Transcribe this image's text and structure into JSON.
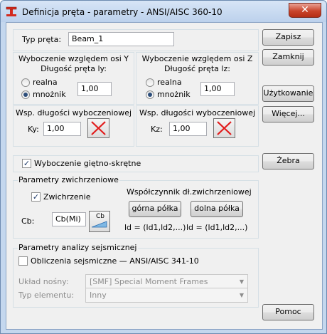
{
  "window": {
    "title": "Definicja pręta - parametry - ANSI/AISC 360-10",
    "close_glyph": "✕"
  },
  "member_type": {
    "label": "Typ pręta:",
    "value": "Beam_1"
  },
  "buckling_y": {
    "header": "Wyboczenie względem osi Y",
    "length_label": "Długość pręta ly:",
    "opt_real": "realna",
    "opt_coef": "mnożnik",
    "selected": "mnożnik",
    "value": "1,00",
    "coef_header": "Wsp. długości wyboczeniowej",
    "coef_label": "Ky:",
    "coef_value": "1,00"
  },
  "buckling_z": {
    "header": "Wyboczenie względem osi Z",
    "length_label": "Długość pręta lz:",
    "opt_real": "realna",
    "opt_coef": "mnożnik",
    "selected": "mnożnik",
    "value": "1,00",
    "coef_header": "Wsp. długości wyboczeniowej",
    "coef_label": "Kz:",
    "coef_value": "1,00"
  },
  "torsional": {
    "label": "Wyboczenie giętno-skrętne",
    "checked": true
  },
  "ltb": {
    "legend": "Parametry zwichrzeniowe",
    "checkbox_label": "Zwichrzenie",
    "checked": true,
    "cb_label": "Cb:",
    "cb_value": "Cb(Mi)",
    "cb_icon_text": "Cb",
    "coef_label": "Współczynnik dł.zwichrzeniowej",
    "top_button": "górna półka",
    "bottom_button": "dolna półka",
    "top_formula": "ld = (ld1,ld2,...)",
    "bottom_formula": "ld = (ld1,ld2,...)"
  },
  "seismic": {
    "legend": "Parametry analizy sejsmicznej",
    "checkbox_label": "Obliczenia sejsmiczne — ANSI/AISC 341-10",
    "checked": false,
    "system_label": "Układ nośny:",
    "system_value": "[SMF] Special Moment Frames",
    "element_label": "Typ elementu:",
    "element_value": "Inny"
  },
  "buttons": {
    "save": "Zapisz",
    "close": "Zamknij",
    "service": "Użytkowanie",
    "more": "Więcej...",
    "ribs": "Żebra",
    "help": "Pomoc"
  },
  "colors": {
    "title_bar": "#c4d7ee",
    "close_button": "#c9442b",
    "cross_red": "#e21b1b",
    "dialog_bg": "#f0f0f0"
  }
}
